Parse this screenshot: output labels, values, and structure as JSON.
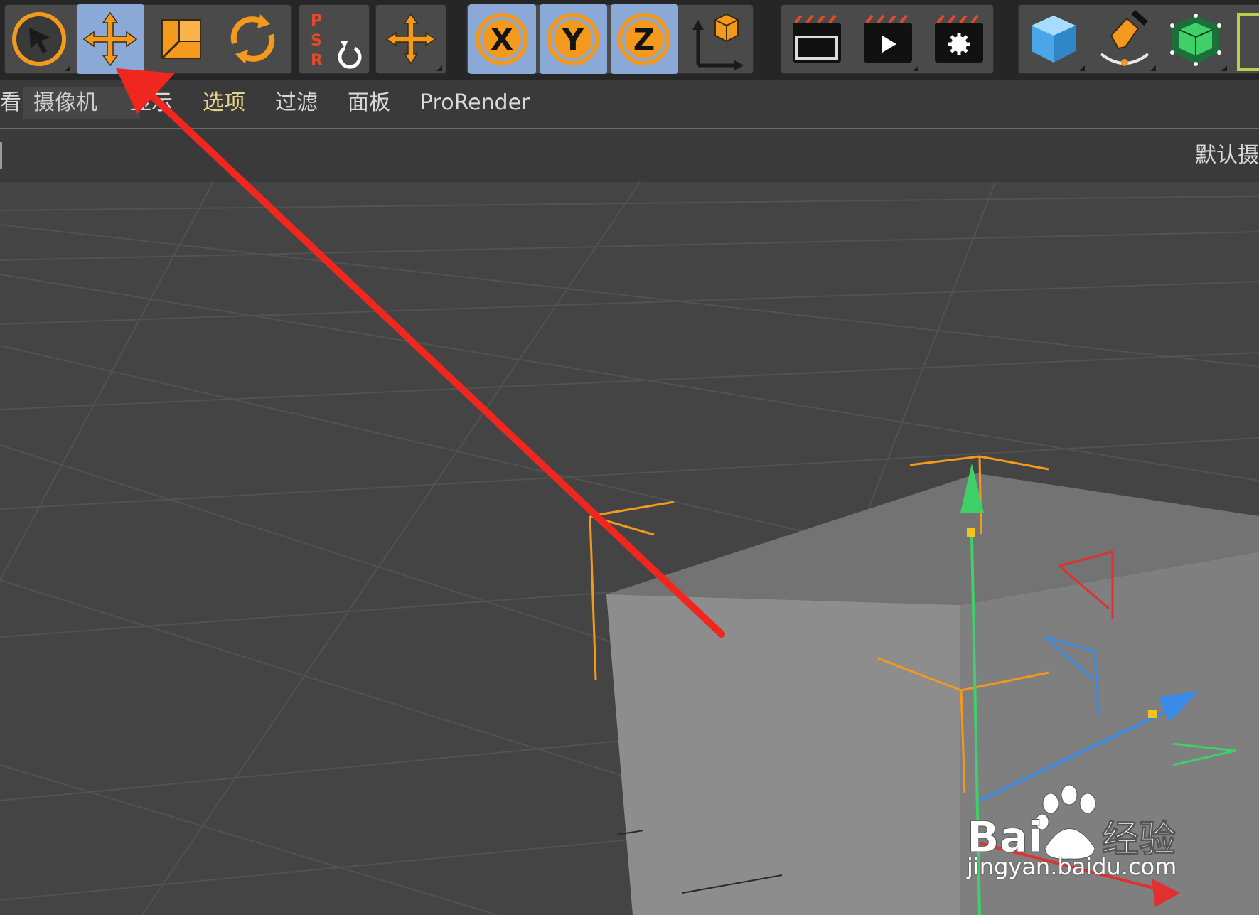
{
  "toolbar": {
    "tools": [
      {
        "id": "live-selection",
        "icon": "cursor-arrow-icon"
      },
      {
        "id": "move",
        "icon": "move-arrows-icon",
        "active": true
      },
      {
        "id": "scale",
        "icon": "scale-icon"
      },
      {
        "id": "rotate",
        "icon": "rotate-icon"
      },
      {
        "id": "psr",
        "icon": "psr-reset-icon",
        "letters": [
          "P",
          "S",
          "R"
        ]
      },
      {
        "id": "axis-move",
        "icon": "axis-move-icon"
      },
      {
        "id": "x-axis",
        "icon": "x-axis-lock-icon",
        "label": "X",
        "active": true
      },
      {
        "id": "y-axis",
        "icon": "y-axis-lock-icon",
        "label": "Y",
        "active": true
      },
      {
        "id": "z-axis",
        "icon": "z-axis-lock-icon",
        "label": "Z",
        "active": true
      },
      {
        "id": "coordinate-system",
        "icon": "world-coordinates-icon"
      },
      {
        "id": "render-view",
        "icon": "clapboard-icon"
      },
      {
        "id": "render-picture-viewer",
        "icon": "clapboard-play-icon"
      },
      {
        "id": "render-settings",
        "icon": "clapboard-gear-icon"
      },
      {
        "id": "cube",
        "icon": "cube-icon"
      },
      {
        "id": "pen",
        "icon": "pen-spline-icon"
      },
      {
        "id": "subdivision",
        "icon": "subdivision-cube-icon"
      }
    ],
    "colors": {
      "accent": "#f39a1e",
      "active_bg": "#8aa9d6"
    }
  },
  "menubar": {
    "items": [
      {
        "label": "看"
      },
      {
        "label": "摄像机",
        "active": true
      },
      {
        "label": "显示"
      },
      {
        "label": "选项",
        "highlight": true
      },
      {
        "label": "过滤"
      },
      {
        "label": "面板"
      },
      {
        "label": "ProRender"
      }
    ]
  },
  "viewport": {
    "camera_label": "默认摄",
    "annotation": {
      "type": "red-arrow",
      "points_to": "move"
    }
  },
  "watermark": {
    "brand": "Bai",
    "brand_suffix": "经验",
    "url": "jingyan.baidu.com"
  }
}
